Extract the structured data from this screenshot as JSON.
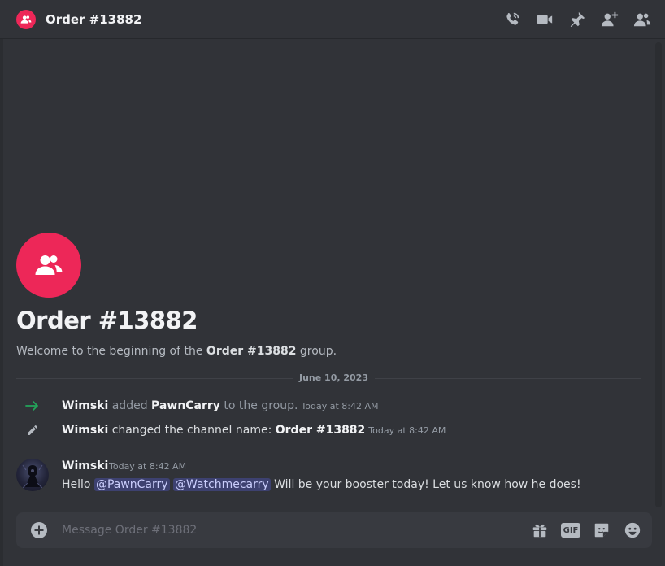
{
  "header": {
    "title": "Order #13882",
    "accent": "#ed2758"
  },
  "header_icons": [
    "phone-call-icon",
    "video-camera-icon",
    "pin-icon",
    "add-friend-icon",
    "member-list-icon"
  ],
  "welcome": {
    "title": "Order #13882",
    "sub_prefix": "Welcome to the beginning of the ",
    "sub_bold": "Order #13882",
    "sub_suffix": " group."
  },
  "date_divider": "June 10, 2023",
  "system_events": [
    {
      "icon": "join-arrow-icon",
      "icon_color": "#23a55a",
      "actor": "Wimski",
      "action": " added ",
      "target": "PawnCarry",
      "suffix": " to the group.",
      "timestamp": "Today at 8:42 AM"
    },
    {
      "icon": "pencil-icon",
      "actor": "Wimski",
      "action": " changed the channel name: ",
      "target": "Order #13882",
      "timestamp": "Today at 8:42 AM"
    }
  ],
  "message": {
    "author": "Wimski",
    "timestamp": "Today at 8:42 AM",
    "text_prefix": "Hello ",
    "mention1": "@PawnCarry",
    "mention2": "@Watchmecarry",
    "text_suffix": " Will be your booster today! Let us know how he does!"
  },
  "composer": {
    "placeholder": "Message Order #13882",
    "gif_label": "GIF"
  },
  "composer_icons": [
    "add-attachment-icon",
    "gift-icon",
    "gif-icon",
    "sticker-icon",
    "emoji-icon"
  ]
}
